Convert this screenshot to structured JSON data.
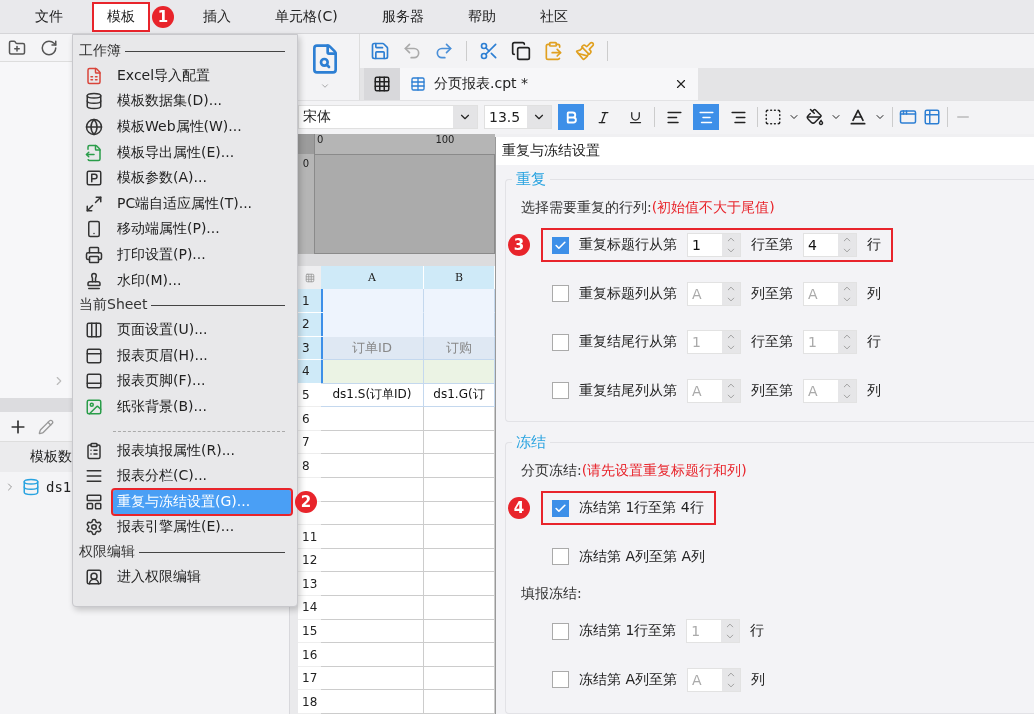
{
  "menubar": [
    {
      "label": "文件",
      "selected": false
    },
    {
      "label": "模板",
      "selected": true,
      "callout": "1"
    },
    {
      "label": "插入",
      "selected": false
    },
    {
      "label": "单元格(C)",
      "selected": false
    },
    {
      "label": "服务器",
      "selected": false
    },
    {
      "label": "帮助",
      "selected": false
    },
    {
      "label": "社区",
      "selected": false
    }
  ],
  "left_panel": {
    "header": "模板数",
    "datasets": [
      {
        "label": "ds1",
        "expanded": false
      }
    ]
  },
  "template_menu": {
    "sections": [
      {
        "title": "工作簿",
        "items": [
          {
            "kind": "item",
            "label": "Excel导入配置",
            "selected": false
          },
          {
            "kind": "item",
            "label": "模板数据集(D)...",
            "selected": false
          },
          {
            "kind": "item",
            "label": "模板Web属性(W)...",
            "selected": false
          },
          {
            "kind": "item",
            "label": "模板导出属性(E)...",
            "selected": false
          },
          {
            "kind": "item",
            "label": "模板参数(A)...",
            "selected": false
          },
          {
            "kind": "item",
            "label": "PC端自适应属性(T)...",
            "selected": false
          },
          {
            "kind": "item",
            "label": "移动端属性(P)...",
            "selected": false
          },
          {
            "kind": "item",
            "label": "打印设置(P)...",
            "selected": false
          },
          {
            "kind": "item",
            "label": "水印(M)...",
            "selected": false
          }
        ]
      },
      {
        "title": "当前Sheet",
        "items": [
          {
            "kind": "item",
            "label": "页面设置(U)...",
            "selected": false
          },
          {
            "kind": "item",
            "label": "报表页眉(H)...",
            "selected": false
          },
          {
            "kind": "item",
            "label": "报表页脚(F)...",
            "selected": false
          },
          {
            "kind": "item",
            "label": "纸张背景(B)...",
            "selected": false
          },
          {
            "kind": "separator"
          },
          {
            "kind": "item",
            "label": "报表填报属性(R)...",
            "selected": false
          },
          {
            "kind": "item",
            "label": "报表分栏(C)...",
            "selected": false
          },
          {
            "kind": "item",
            "label": "重复与冻结设置(G)...",
            "selected": true,
            "callout": "2"
          },
          {
            "kind": "item",
            "label": "报表引擎属性(E)...",
            "selected": false
          }
        ]
      },
      {
        "title": "权限编辑",
        "items": [
          {
            "kind": "item",
            "label": "进入权限编辑",
            "selected": false
          }
        ]
      }
    ]
  },
  "document_tab": {
    "label": "分页报表.cpt *",
    "selected": true
  },
  "format_bar": {
    "font": "宋体",
    "font_size": "13.5",
    "bold": true,
    "italic": false,
    "underline": false,
    "align": [
      {
        "selected": false
      },
      {
        "selected": true
      },
      {
        "selected": false
      }
    ]
  },
  "ruler": {
    "top_labels": [
      "0",
      "100"
    ],
    "side_label": "0"
  },
  "sheet": {
    "columns": [
      "A",
      "B"
    ],
    "rows": [
      {
        "number": "1",
        "kind": "title",
        "selected": true,
        "cells": []
      },
      {
        "number": "2",
        "kind": "title",
        "selected": true,
        "cells": []
      },
      {
        "number": "3",
        "kind": "header",
        "selected": true,
        "cells": [
          "订单ID",
          "订购"
        ]
      },
      {
        "number": "4",
        "kind": "spacer",
        "selected": true,
        "cells": []
      },
      {
        "number": "5",
        "kind": "data",
        "selected": false,
        "cells": [
          "ds1.S(订单ID)",
          "ds1.G(订"
        ]
      },
      {
        "number": "6",
        "kind": "empty",
        "selected": false,
        "cells": []
      },
      {
        "number": "7",
        "kind": "empty",
        "selected": false,
        "cells": []
      },
      {
        "number": "8",
        "kind": "empty",
        "selected": false,
        "cells": []
      },
      {
        "kind": "empty",
        "selected": false,
        "cells": []
      },
      {
        "kind": "empty",
        "selected": false,
        "cells": []
      },
      {
        "number": "11",
        "kind": "empty",
        "selected": false,
        "cells": []
      },
      {
        "number": "12",
        "kind": "empty",
        "selected": false,
        "cells": []
      },
      {
        "number": "13",
        "kind": "empty",
        "selected": false,
        "cells": []
      },
      {
        "number": "14",
        "kind": "empty",
        "selected": false,
        "cells": []
      },
      {
        "number": "15",
        "kind": "empty",
        "selected": false,
        "cells": []
      },
      {
        "number": "16",
        "kind": "empty",
        "selected": false,
        "cells": []
      },
      {
        "number": "17",
        "kind": "empty",
        "selected": false,
        "cells": []
      },
      {
        "number": "18",
        "kind": "empty",
        "selected": false,
        "cells": []
      }
    ]
  },
  "dialog": {
    "title": "重复与冻结设置",
    "repeat": {
      "legend": "重复",
      "prompt": "选择需要重复的行列:",
      "hint": "(初始值不大于尾值)",
      "rows": [
        {
          "checked": true,
          "label": "重复标题行从第",
          "from": "1",
          "middle": "行至第",
          "to": "4",
          "unit": "行",
          "callout": "3"
        },
        {
          "checked": false,
          "label": "重复标题列从第",
          "from": "A",
          "middle": "列至第",
          "to": "A",
          "unit": "列"
        },
        {
          "checked": false,
          "label": "重复结尾行从第",
          "from": "1",
          "middle": "行至第",
          "to": "1",
          "unit": "行"
        },
        {
          "checked": false,
          "label": "重复结尾列从第",
          "from": "A",
          "middle": "列至第",
          "to": "A",
          "unit": "列"
        }
      ]
    },
    "freeze": {
      "legend": "冻结",
      "paging_prompt": "分页冻结:",
      "paging_hint": "(请先设置重复标题行和列)",
      "paging_rows": [
        {
          "checked": true,
          "label": "冻结第 1行至第 4行",
          "callout": "4"
        },
        {
          "checked": false,
          "label": "冻结第 A列至第 A列"
        }
      ],
      "fill_prompt": "填报冻结:",
      "fill_rows": [
        {
          "checked": false,
          "label": "冻结第 1行至第",
          "to": "1",
          "unit": "行"
        },
        {
          "checked": false,
          "label": "冻结第 A列至第",
          "to": "A",
          "unit": "列"
        }
      ]
    }
  }
}
